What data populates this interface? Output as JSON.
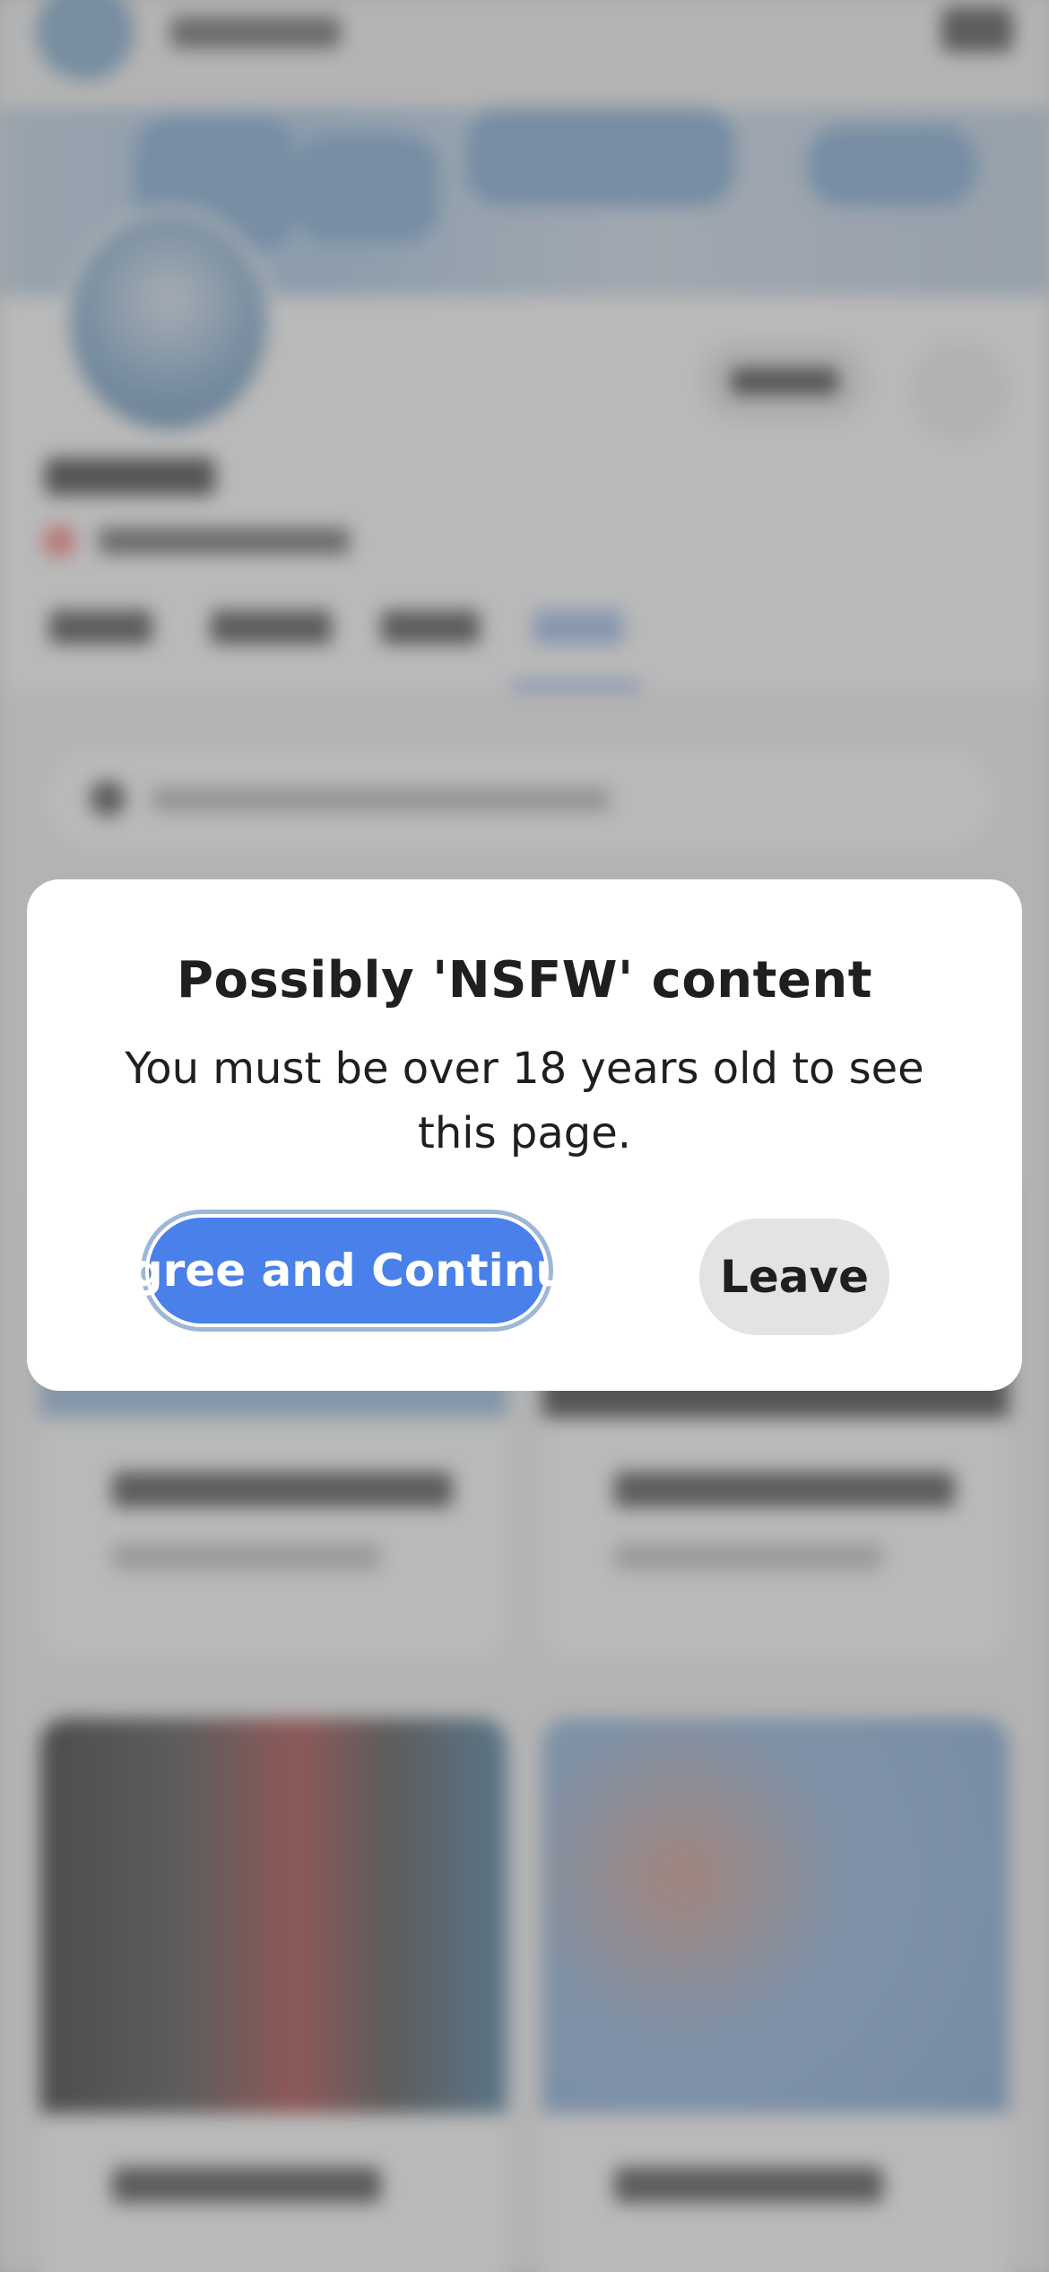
{
  "modal": {
    "title": "Possibly 'NSFW' content",
    "message": "You must be over 18 years old to see this page.",
    "agree_label": "Agree and Continue",
    "leave_label": "Leave"
  },
  "colors": {
    "primary_button": "#4a80ea",
    "secondary_button": "#e5e3e2",
    "overlay": "rgba(128,128,128,0.55)",
    "modal_background": "#ffffff"
  }
}
